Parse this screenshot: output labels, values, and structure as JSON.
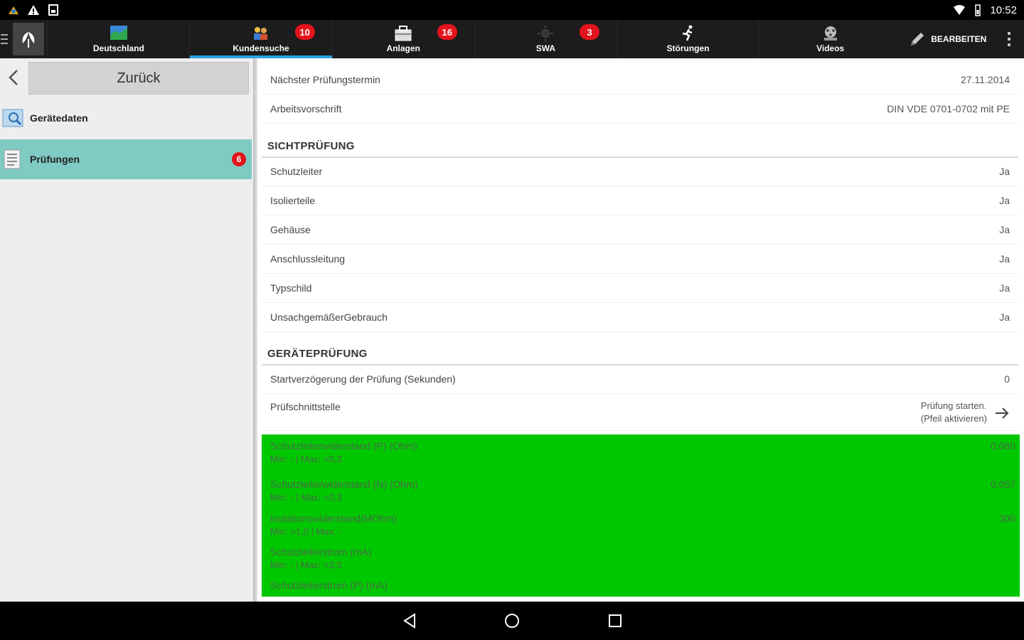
{
  "statusbar": {
    "time": "10:52"
  },
  "topbar": {
    "tabs": [
      {
        "label": "Deutschland",
        "badge": "",
        "icon": "map-icon"
      },
      {
        "label": "Kundensuche",
        "badge": "10",
        "icon": "people-icon",
        "active": true
      },
      {
        "label": "Anlagen",
        "badge": "16",
        "icon": "toolbox-icon"
      },
      {
        "label": "SWA",
        "badge": "3",
        "icon": "sun-icon"
      },
      {
        "label": "Störungen",
        "badge": "",
        "icon": "runner-icon"
      },
      {
        "label": "Videos",
        "badge": "",
        "icon": "film-icon"
      }
    ],
    "edit_label": "BEARBEITEN",
    "accent": "#2aa3df",
    "badge_color": "#e3141b"
  },
  "sidebar": {
    "back_label": "Zurück",
    "items": [
      {
        "label": "Gerätedaten",
        "icon": "device-data-icon"
      },
      {
        "label": "Prüfungen",
        "icon": "checklist-icon",
        "badge": "6",
        "selected": true
      }
    ],
    "selected_color": "#7fcac2"
  },
  "main": {
    "rows_top": [
      {
        "label": "Nächster Prüfungstermin",
        "value": "27.11.2014"
      },
      {
        "label": "Arbeitsvorschrift",
        "value": "DIN VDE 0701-0702 mit PE"
      }
    ],
    "section1": "SICHTPRÜFUNG",
    "visual_checks": [
      {
        "label": "Schutzleiter",
        "value": "Ja"
      },
      {
        "label": "Isolierteile",
        "value": "Ja"
      },
      {
        "label": "Gehäuse",
        "value": "Ja"
      },
      {
        "label": "Anschlussleitung",
        "value": "Ja"
      },
      {
        "label": "Typschild",
        "value": "Ja"
      },
      {
        "label": "UnsachgemäßerGebrauch",
        "value": "Ja"
      }
    ],
    "section2": "GERÄTEPRÜFUNG",
    "delay_row": {
      "label": "Startverzögerung der Prüfung (Sekunden)",
      "value": "0"
    },
    "interface_row": {
      "label": "Prüfschnittstelle",
      "value_line1": "Prüfung starten.",
      "value_line2": "(Pfeil aktivieren)"
    },
    "measurements_color": "#00c800",
    "measurements": [
      {
        "name": "Schutzleiterwiderstand (P) (Ohm)",
        "limits": "Min: - | Max: <0,3",
        "value": "0.060"
      },
      {
        "name": "Schutzleiterwiderstand (N) (Ohm)",
        "limits": "Min: - | Max: <0,3",
        "value": "0.057"
      },
      {
        "name": "Isolationswiderstand(MOhm)",
        "limits": "Min: >1,0 | Max: -",
        "value": "300"
      },
      {
        "name": "Schutzleiterstrom (mA)",
        "limits": "Min: - | Max: <3,5",
        "value": ""
      },
      {
        "name": "Schutzleiterstrom (P) (mA)",
        "limits": "",
        "value": ""
      }
    ]
  }
}
